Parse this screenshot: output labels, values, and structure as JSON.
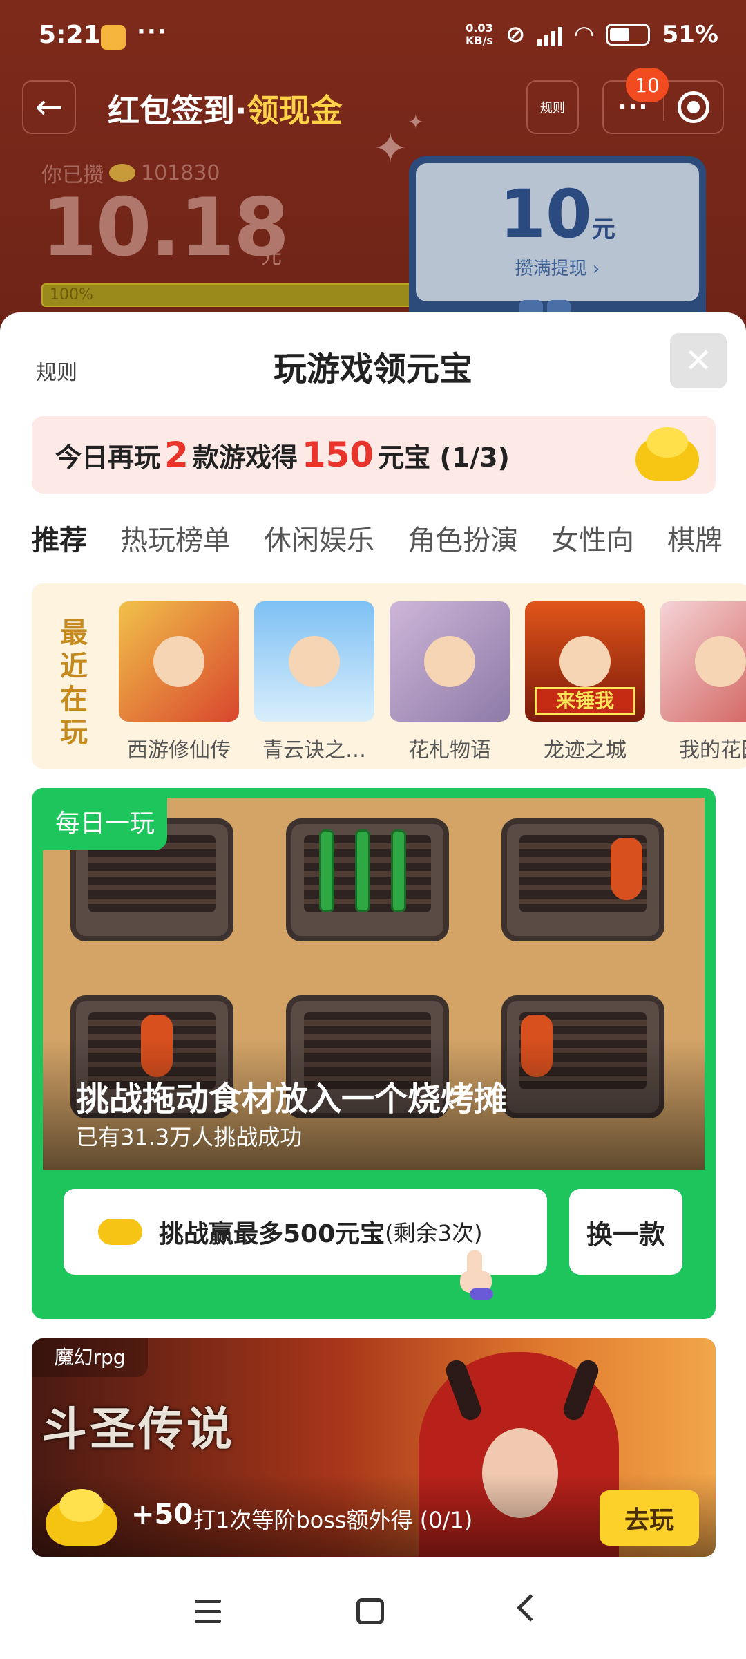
{
  "status_bar": {
    "time": "5:21",
    "more": "···",
    "net_speed_top": "0.03",
    "net_speed_bottom": "KB/s",
    "battery": "51%"
  },
  "nav": {
    "title_main": "红包签到·",
    "title_accent": "领现金",
    "rules": "规则",
    "badge": "10",
    "more": "···"
  },
  "wallet": {
    "saved_label": "你已攒",
    "coins": "101830",
    "amount": "10.18",
    "amount_unit": "元",
    "progress_text": "100%",
    "progress": 1.0,
    "cash_value": "10",
    "cash_unit": "元",
    "cash_link": "攒满提现 ›"
  },
  "sheet": {
    "rules": "规则",
    "title": "玩游戏领元宝",
    "close": "✕",
    "task": {
      "pre": "今日再玩",
      "games_count": "2",
      "mid": "款游戏得",
      "reward": "150",
      "post": "元宝 (1/3)"
    },
    "tabs": [
      "推荐",
      "热玩榜单",
      "休闲娱乐",
      "角色扮演",
      "女性向",
      "棋牌"
    ],
    "recent_label": "最近在玩",
    "recent_games": [
      {
        "name": "西游修仙传"
      },
      {
        "name": "青云诀之…"
      },
      {
        "name": "花札物语"
      },
      {
        "name": "龙迹之城",
        "thumb_text": "来锤我"
      },
      {
        "name": "我的花园"
      }
    ],
    "daily": {
      "tag": "每日一玩",
      "caption": "挑战拖动食材放入一个烧烤摊",
      "sub": "已有31.3万人挑战成功",
      "challenge_main": "挑战赢最多500元宝",
      "challenge_small": "(剩余3次)",
      "swap": "换一款"
    },
    "rpg": {
      "tag": "魔幻rpg",
      "logo": "斗圣传说",
      "plus": "+50",
      "desc": "打1次等阶boss额外得 (0/1)",
      "go": "去玩"
    }
  },
  "colors": {
    "header_bg": "#7e2a1b",
    "accent_yellow": "#ffd24a",
    "daily_green": "#1ec45c",
    "task_red": "#e8342a",
    "go_button": "#fbd12a"
  }
}
